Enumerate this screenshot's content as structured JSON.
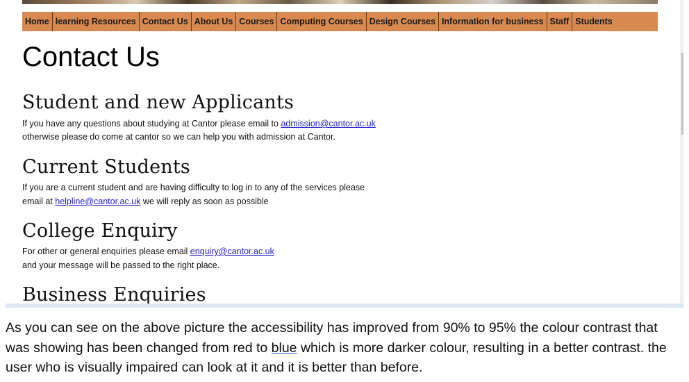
{
  "nav": {
    "items": [
      "Home",
      "learning Resources",
      "Contact Us",
      "About Us",
      "Courses",
      "Computing Courses",
      "Design Courses",
      "Information for business",
      "Staff",
      "Students"
    ]
  },
  "page_title": "Contact Us",
  "sections": [
    {
      "heading": "Student and new Applicants",
      "line1_text": "If you have any questions about studying at Cantor please email to ",
      "line1_link": "admission@cantor.ac.uk",
      "line2_text": "otherwise please do come at cantor so we can help you with admission at Cantor."
    },
    {
      "heading": "Current Students",
      "line1_text": "If you are a current student and are having difficulty to log in to any of the services please",
      "line2_pre": "email at ",
      "line2_link": "helpline@cantor.ac.uk",
      "line2_post": " we will reply as soon as possible"
    },
    {
      "heading": "College Enquiry",
      "line1_text": "For other or general enquiries please email ",
      "line1_link": "enquiry@cantor.ac.uk",
      "line2_text": "and your message will be passed to the right place."
    },
    {
      "heading": "Business Enquiries"
    }
  ],
  "scrollbar": {
    "up_arrow": "▲",
    "down_arrow": "▼"
  },
  "caption": {
    "part1": "As you can see on the above picture the accessibility has improved from 90% to 95% the colour contrast that was showing has been changed from red to ",
    "underlined": "blue",
    "part2": " which is more darker colour, resulting in a better contrast. the user who is visually impaired can look at it and it is better than before."
  },
  "colors": {
    "nav_background": "#d8894f",
    "link": "#2222cc"
  }
}
